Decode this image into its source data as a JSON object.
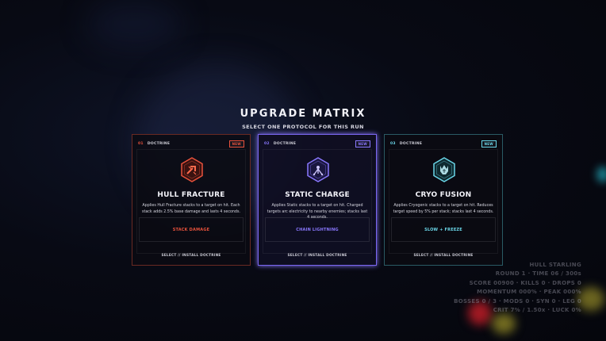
{
  "title": "UPGRADE MATRIX",
  "subtitle": "SELECT ONE PROTOCOL FOR THIS RUN",
  "cards": [
    {
      "index": "01",
      "kind": "DOCTRINE",
      "badge": "NEW",
      "icon": "arrow-burst-icon",
      "name": "HULL FRACTURE",
      "description": "Applies Hull Fracture stacks to a target on hit. Each stack adds 2.5% base damage and lasts 4 seconds.",
      "tag": "STACK DAMAGE",
      "footer": "SELECT // INSTALL DOCTRINE",
      "accent": "#e8523c",
      "border": "#6a2a22"
    },
    {
      "index": "02",
      "kind": "DOCTRINE",
      "badge": "NEW",
      "icon": "lightning-node-icon",
      "name": "STATIC CHARGE",
      "description": "Applies Static stacks to a target on hit. Charged targets arc electricity to nearby enemies; stacks last 4 seconds.",
      "tag": "CHAIN LIGHTNING",
      "footer": "SELECT // INSTALL DOCTRINE",
      "accent": "#8a78ff",
      "border": "#7a66f0"
    },
    {
      "index": "03",
      "kind": "DOCTRINE",
      "badge": "NEW",
      "icon": "crystal-fist-icon",
      "name": "CRYO FUSION",
      "description": "Applies Cryogenic stacks to a target on hit. Reduces target speed by 5% per stack; stacks last 4 seconds.",
      "tag": "SLOW + FREEZE",
      "footer": "SELECT // INSTALL DOCTRINE",
      "accent": "#6ad6e8",
      "border": "#2a5a64"
    }
  ],
  "hud": [
    "HULL STARLING",
    "ROUND 1 · TIME 06 / 300s",
    "SCORE 00900 · KILLS 0 · DROPS 0",
    "MOMENTUM 000% · PEAK 000%",
    "BOSSES 0 / 3 · MODS 0 · SYN 0 · LEG 0",
    "CRIT 7% / 1.50x · LUCK 0%"
  ]
}
